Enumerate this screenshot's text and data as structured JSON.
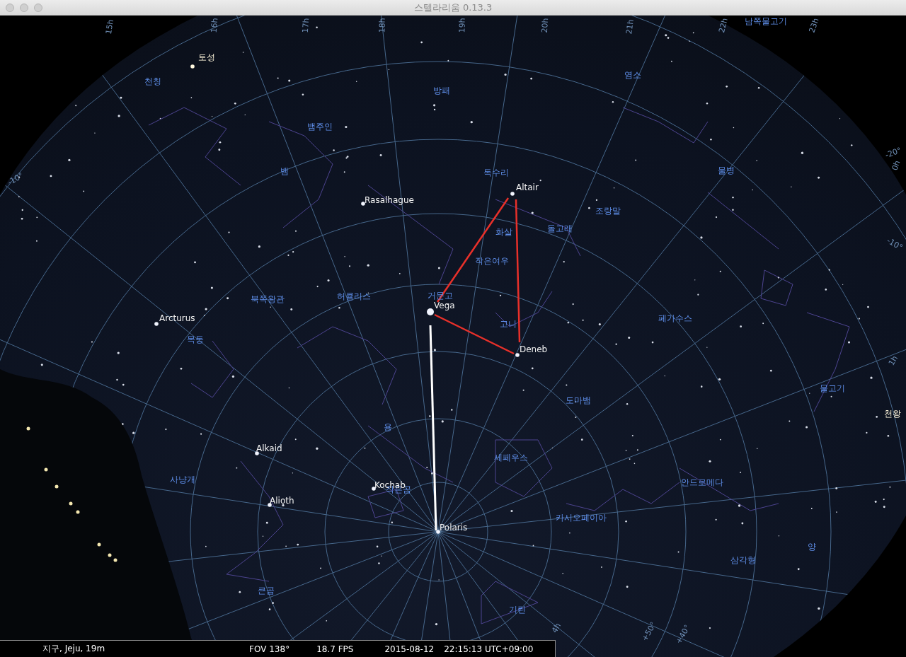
{
  "window": {
    "title": "스텔라리움 0.13.3"
  },
  "grid_labels": [
    "15h",
    "16h",
    "17h",
    "18h",
    "19h",
    "20h",
    "21h",
    "22h",
    "23h",
    "-20°",
    "0h",
    "-10°",
    "1h",
    "-10°",
    "4h",
    "+50°",
    "+40°"
  ],
  "constellations": [
    "남쪽물고기",
    "천칭",
    "염소",
    "방패",
    "뱀주인",
    "뱀",
    "독수리",
    "물병",
    "조랑말",
    "화살",
    "돌고래",
    "작은여우",
    "북쪽왕관",
    "허큘리스",
    "거문고",
    "고니",
    "페가수스",
    "목동",
    "물고기",
    "도마뱀",
    "용",
    "세페우스",
    "사냥개",
    "작은곰",
    "안드로메다",
    "카시오페이아",
    "삼각형",
    "양",
    "큰곰",
    "기린"
  ],
  "objects": [
    {
      "name": "토성",
      "kind": "planet"
    },
    {
      "name": "Altair",
      "kind": "star"
    },
    {
      "name": "Rasalhague",
      "kind": "star"
    },
    {
      "name": "Vega",
      "kind": "star"
    },
    {
      "name": "Arcturus",
      "kind": "star"
    },
    {
      "name": "Deneb",
      "kind": "star"
    },
    {
      "name": "천왕",
      "kind": "planet"
    },
    {
      "name": "Alkaid",
      "kind": "star"
    },
    {
      "name": "Kochab",
      "kind": "star"
    },
    {
      "name": "Alioth",
      "kind": "star"
    },
    {
      "name": "Polaris",
      "kind": "star"
    }
  ],
  "status_bar": {
    "location": "지구, Jeju, 19m",
    "fov": "FOV 138°",
    "fps": "18.7 FPS",
    "date": "2015-08-12",
    "time": "22:15:13 UTC+09:00"
  }
}
